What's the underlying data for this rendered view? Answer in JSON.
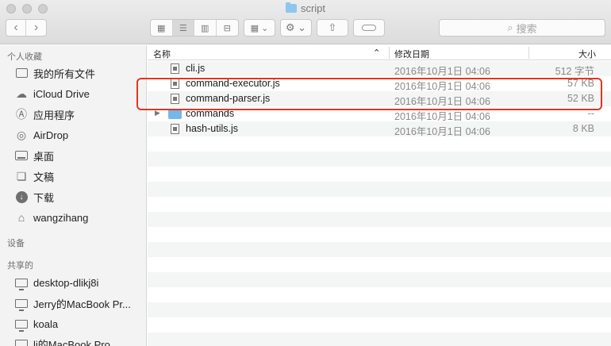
{
  "window": {
    "title": "script"
  },
  "toolbar": {
    "back_icon": "chevron-left-icon",
    "forward_icon": "chevron-right-icon",
    "view_icons": [
      "icon-view-icon",
      "list-view-icon",
      "column-view-icon",
      "cover-flow-icon"
    ],
    "search_placeholder": "搜索"
  },
  "sidebar": {
    "favorites_title": "个人收藏",
    "favorites": [
      {
        "label": "我的所有文件",
        "icon": "all-files-icon"
      },
      {
        "label": "iCloud Drive",
        "icon": "cloud-icon"
      },
      {
        "label": "应用程序",
        "icon": "applications-icon"
      },
      {
        "label": "AirDrop",
        "icon": "airdrop-icon"
      },
      {
        "label": "桌面",
        "icon": "desktop-icon"
      },
      {
        "label": "文稿",
        "icon": "documents-icon"
      },
      {
        "label": "下载",
        "icon": "downloads-icon"
      },
      {
        "label": "wangzihang",
        "icon": "home-icon"
      }
    ],
    "devices_title": "设备",
    "shared_title": "共享的",
    "shared": [
      {
        "label": "desktop-dlikj8i",
        "icon": "computer-icon"
      },
      {
        "label": "Jerry的MacBook Pr...",
        "icon": "computer-icon"
      },
      {
        "label": "koala",
        "icon": "computer-icon"
      },
      {
        "label": "li的MacBook Pro",
        "icon": "computer-icon"
      }
    ]
  },
  "list": {
    "columns": {
      "name": "名称",
      "modified": "修改日期",
      "size": "大小"
    },
    "files": [
      {
        "name": "cli.js",
        "modified": "2016年10月1日 04:06",
        "size": "512 字节",
        "kind": "file"
      },
      {
        "name": "command-executor.js",
        "modified": "2016年10月1日 04:06",
        "size": "57 KB",
        "kind": "file"
      },
      {
        "name": "command-parser.js",
        "modified": "2016年10月1日 04:06",
        "size": "52 KB",
        "kind": "file"
      },
      {
        "name": "commands",
        "modified": "2016年10月1日 04:06",
        "size": "--",
        "kind": "folder"
      },
      {
        "name": "hash-utils.js",
        "modified": "2016年10月1日 04:06",
        "size": "8 KB",
        "kind": "file"
      }
    ]
  },
  "colors": {
    "highlight": "#e8331e",
    "folder": "#75b7ea",
    "sidebar_bg": "#f4f3f4"
  }
}
